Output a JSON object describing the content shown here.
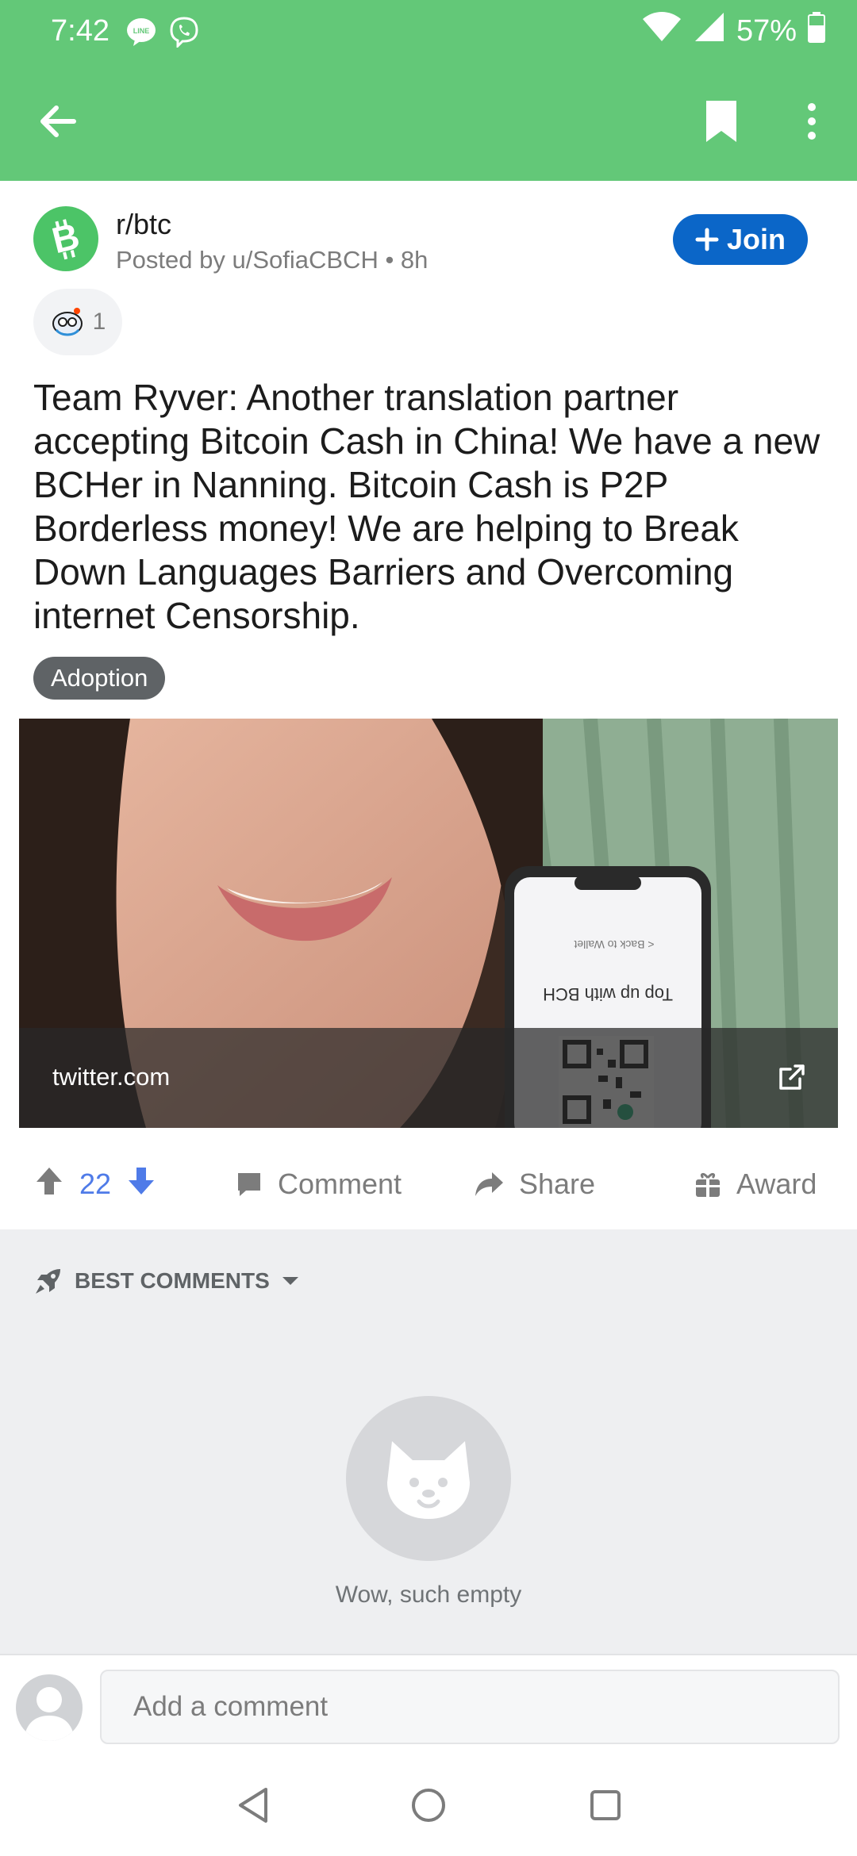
{
  "status_bar": {
    "time": "7:42",
    "battery": "57%"
  },
  "subreddit": {
    "name": "r/btc",
    "meta": "Posted by u/SofiaCBCH • 8h"
  },
  "join_label": "Join",
  "award_count": "1",
  "post": {
    "title": "Team Ryver: Another translation partner accepting Bitcoin Cash in China! We have a new BCHer in Nanning. Bitcoin Cash is P2P Borderless money! We are helping to Break Down Languages Barriers and Overcoming internet Censorship.",
    "flair": "Adoption"
  },
  "preview": {
    "domain": "twitter.com",
    "phone_text_1": "Top up with BCH",
    "phone_text_2": "< Back to Wallet"
  },
  "actions": {
    "score": "22",
    "comment_label": "Comment",
    "share_label": "Share",
    "award_label": "Award"
  },
  "comments": {
    "sort_label": "BEST COMMENTS",
    "empty_text": "Wow, such empty"
  },
  "comment_input": {
    "placeholder": "Add a comment"
  },
  "colors": {
    "toolbar": "#63c878",
    "join": "#0b66c8",
    "score": "#4f7be8",
    "flair": "#5f6366"
  }
}
